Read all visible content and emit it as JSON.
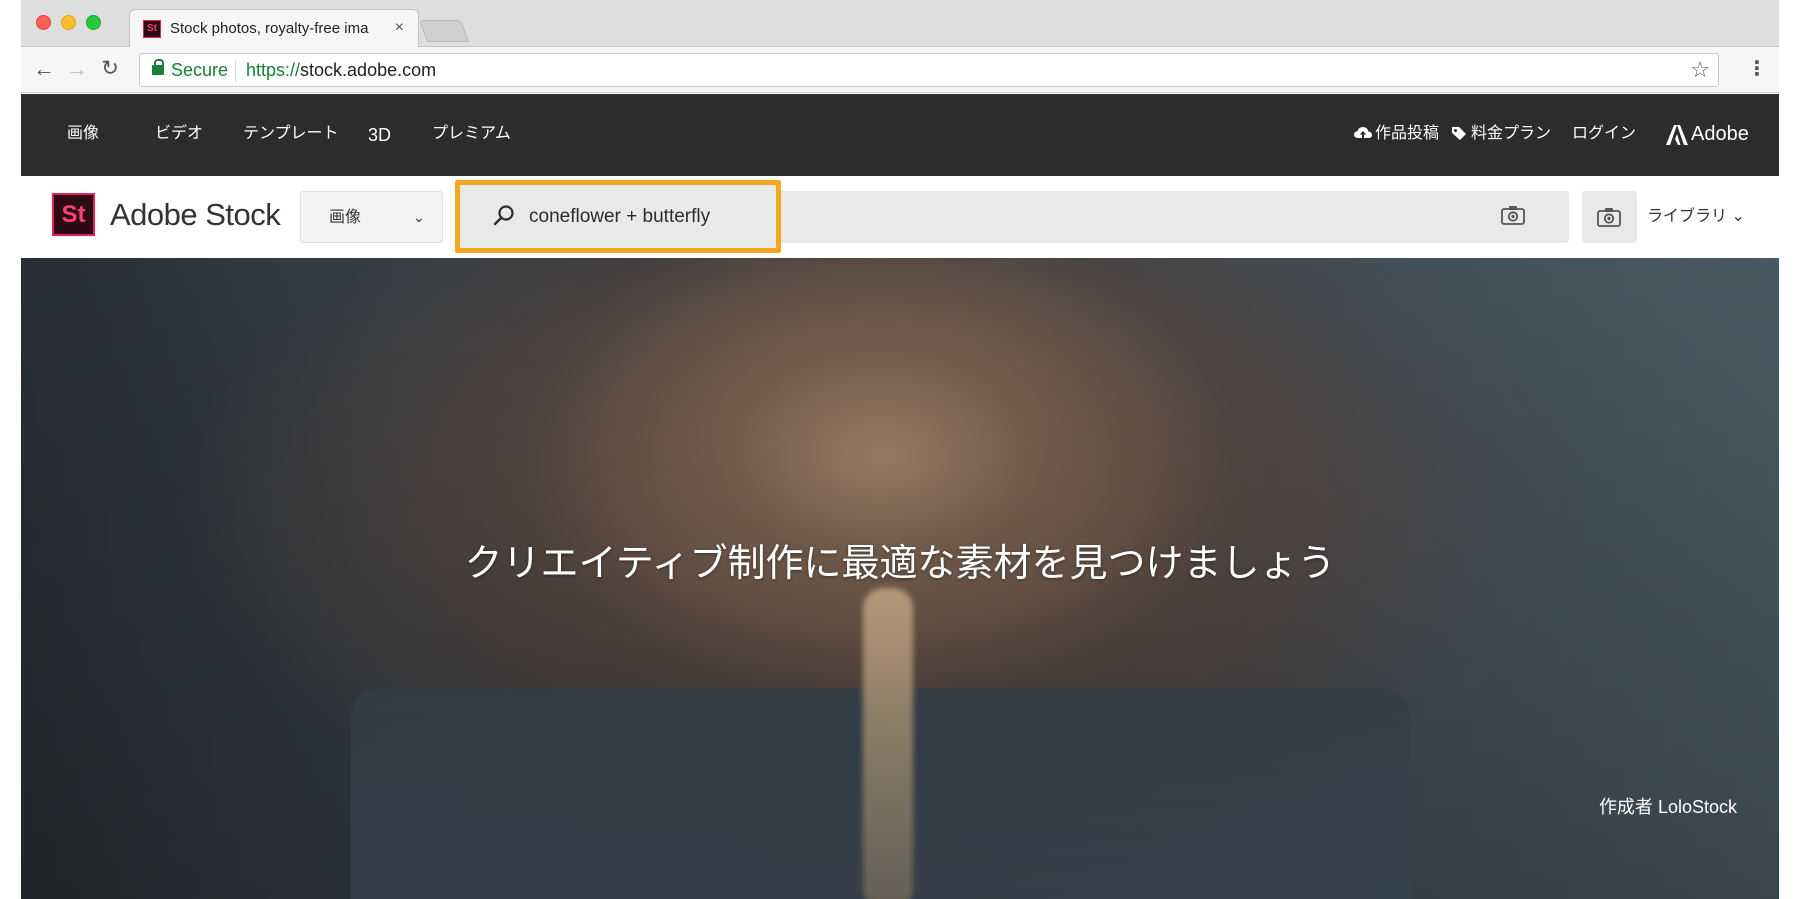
{
  "browser": {
    "tab": {
      "favicon_text": "St",
      "title": "Stock photos, royalty-free ima",
      "close": "×"
    },
    "omnibox": {
      "secure_label": "Secure",
      "url_scheme": "https://",
      "url_host": "stock.adobe.com"
    }
  },
  "topnav": {
    "items": [
      "画像",
      "ビデオ",
      "テンプレート",
      "3D",
      "プレミアム"
    ],
    "upload_label": "作品投稿",
    "pricing_label": "料金プラン",
    "login_label": "ログイン",
    "brand": "Adobe"
  },
  "stockbar": {
    "logo_text": "St",
    "product_name": "Adobe Stock",
    "type_select": {
      "selected": "画像"
    },
    "search": {
      "value": "coneflower + butterfly"
    },
    "library_label": "ライブラリ"
  },
  "hero": {
    "headline": "クリエイティブ制作に最適な素材を見つけましょう",
    "credit": "作成者 LoloStock"
  },
  "colors": {
    "highlight": "#f4a71f",
    "stock_brand": "#e61e5a",
    "nav_bg": "#2c2c2c",
    "secure_green": "#188038"
  }
}
